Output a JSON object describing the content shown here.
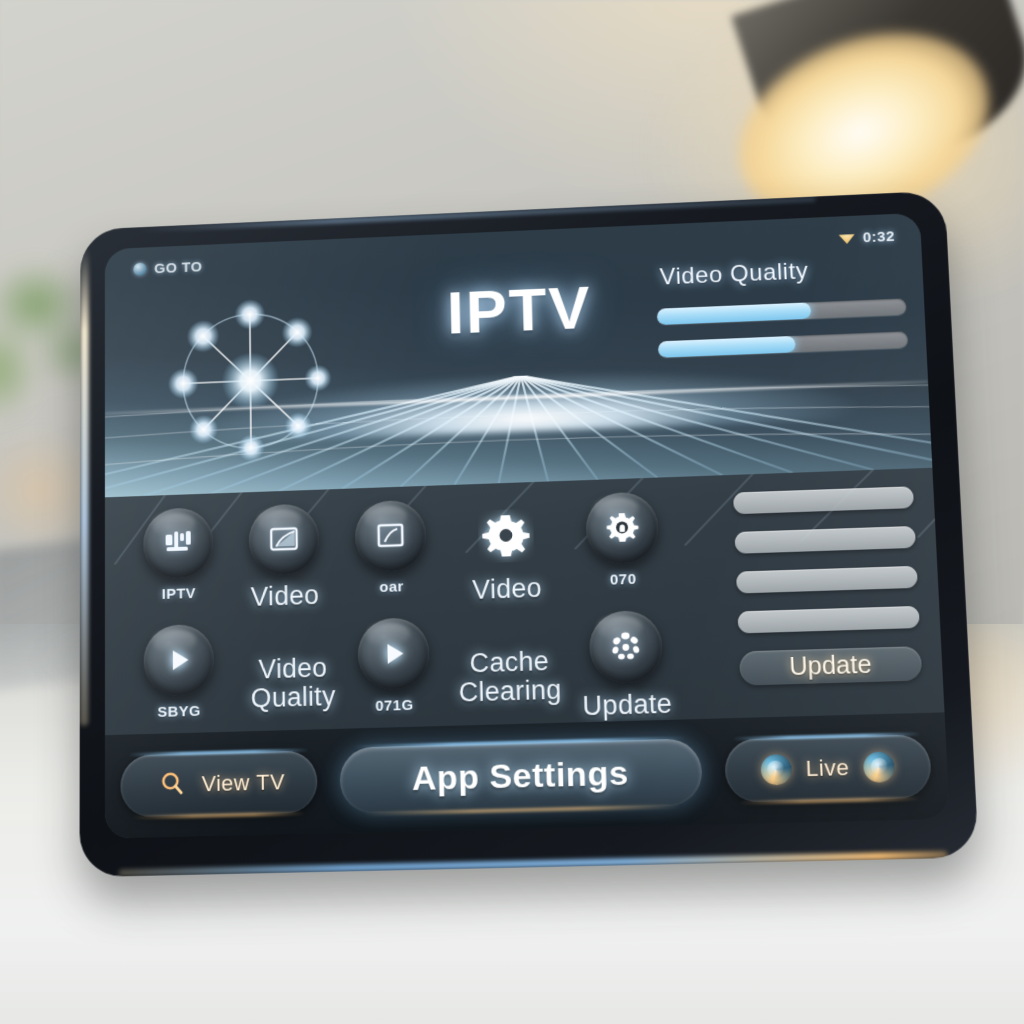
{
  "scene": {
    "device": "tablet",
    "lamp_icon": "desk-lamp-icon",
    "plant_icon": "potted-plant-icon"
  },
  "statusbar": {
    "left_icon": "app-status-icon",
    "left_text": "GO TO",
    "wifi_icon": "wifi-icon",
    "clock": "0:32"
  },
  "hero": {
    "logo_icon": "network-nodes-icon",
    "title": "IPTV",
    "video_quality": {
      "label": "Video Quality",
      "sliders": [
        {
          "name": "quality-slider-1",
          "value": 62
        },
        {
          "name": "quality-slider-2",
          "value": 55
        }
      ]
    }
  },
  "grid": {
    "row1": [
      {
        "icon": "antenna-icon",
        "label": "IPTV"
      },
      {
        "icon": "screen-cast-icon",
        "label": "Video"
      },
      {
        "icon": "screen-frame-icon",
        "label": "oar"
      },
      {
        "icon": "gear-icon",
        "label": "Video"
      },
      {
        "icon": "settings-lock-icon",
        "label": "070"
      }
    ],
    "row2": [
      {
        "icon": "play-icon",
        "label": "SBYG"
      },
      {
        "icon": "none",
        "label": "Video Quality"
      },
      {
        "icon": "play-icon",
        "label": "071G"
      },
      {
        "icon": "none",
        "label": "Cache Clearing"
      },
      {
        "icon": "spinner-icon",
        "label": "Update"
      }
    ]
  },
  "right_list": {
    "placeholder_bars": 4,
    "button_label": "Update"
  },
  "bottombar": {
    "left_pill": {
      "icon": "search-icon",
      "label": "View TV"
    },
    "main_button": {
      "label": "App Settings"
    },
    "right_pill": {
      "icon_left": "orb-icon",
      "label": "Live",
      "icon_right": "orb-icon"
    }
  },
  "colors": {
    "accent_blue": "#8cc9f5",
    "accent_amber": "#ffc882",
    "screen_dark": "#2e3840",
    "bezel": "#141a20"
  }
}
